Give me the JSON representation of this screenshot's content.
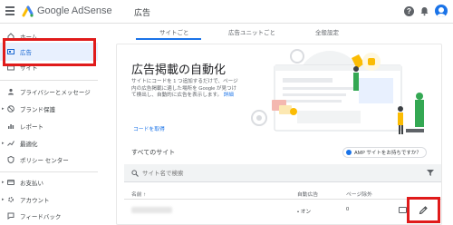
{
  "app": {
    "brand": "Google AdSense",
    "page_title": "広告"
  },
  "topbar": {
    "help_icon": "help-icon",
    "bell_icon": "bell-icon",
    "avatar_icon": "avatar"
  },
  "sidebar": {
    "items": [
      {
        "label": "ホーム",
        "icon": "home-icon"
      },
      {
        "label": "広告",
        "icon": "ads-icon"
      },
      {
        "label": "サイト",
        "icon": "sites-icon"
      },
      {
        "label": "プライバシーとメッセージ",
        "icon": "privacy-icon"
      },
      {
        "label": "ブランド保護",
        "icon": "brand-safety-icon"
      },
      {
        "label": "レポート",
        "icon": "reports-icon"
      },
      {
        "label": "最適化",
        "icon": "optimization-icon"
      },
      {
        "label": "ポリシー センター",
        "icon": "policy-icon"
      },
      {
        "label": "お支払い",
        "icon": "payments-icon"
      },
      {
        "label": "アカウント",
        "icon": "account-icon"
      },
      {
        "label": "フィードバック",
        "icon": "feedback-icon"
      }
    ]
  },
  "tabs": [
    "サイトごと",
    "広告ユニットごと",
    "全般設定"
  ],
  "auto_ads": {
    "heading": "広告掲載の自動化",
    "description": "サイトにコードを 1 つ追加するだけで、ページ内の広告掲載に適した場所を Google が見つけて検出し、自動的に広告を表示します。",
    "details_link": "詳細",
    "get_code": "コードを取得"
  },
  "sites": {
    "title": "すべてのサイト",
    "amp_chip": "AMP サイトをお持ちですか？",
    "search_placeholder": "サイト名で検索",
    "columns": {
      "name": "名前 ↑",
      "auto_ads": "自動広告",
      "page_exclusions": "ページ除外"
    },
    "rows": [
      {
        "auto_ads": "• オン",
        "page_exclusions": "0"
      }
    ]
  },
  "colors": {
    "accent": "#1a73e8",
    "highlight": "#e01b1b",
    "active_bg": "#e8f0fe"
  }
}
